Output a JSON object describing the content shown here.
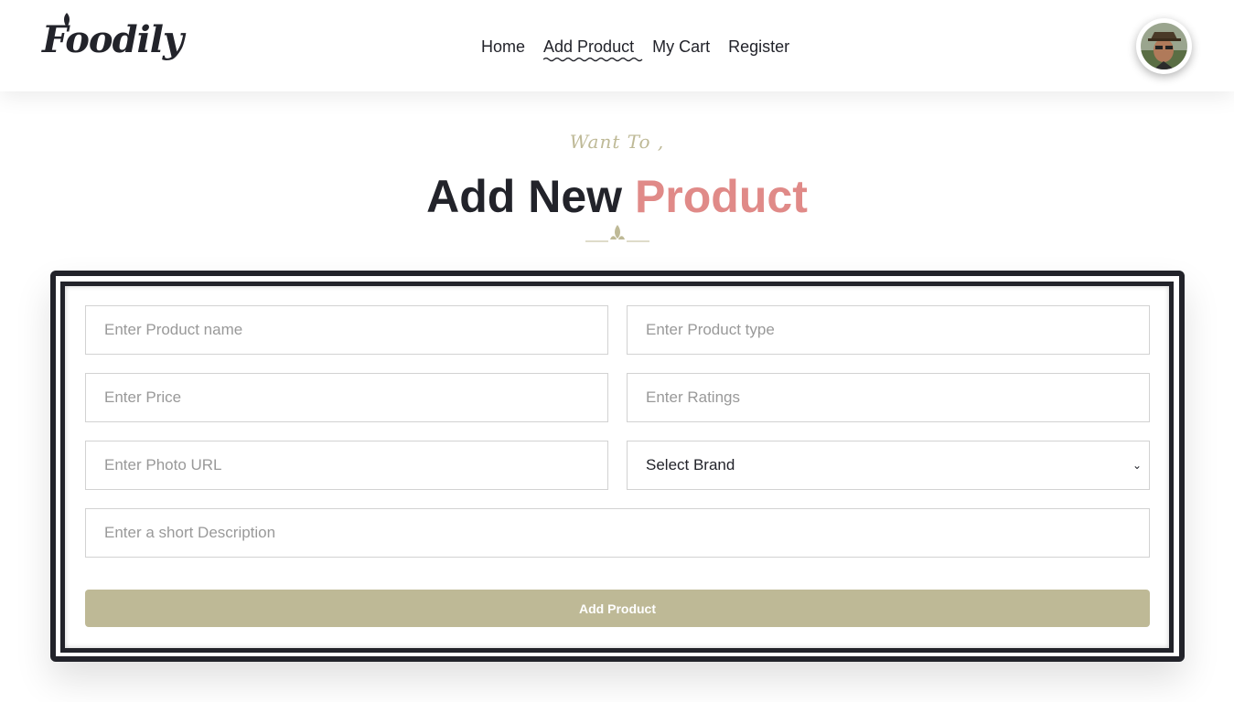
{
  "header": {
    "logo": "Foodily",
    "nav": [
      {
        "label": "Home"
      },
      {
        "label": "Add Product"
      },
      {
        "label": "My Cart"
      },
      {
        "label": "Register"
      }
    ]
  },
  "hero": {
    "eyebrow": "Want To ,",
    "title_main": "Add New",
    "title_accent": "Product"
  },
  "form": {
    "product_name_placeholder": "Enter Product name",
    "product_type_placeholder": "Enter Product type",
    "price_placeholder": "Enter Price",
    "ratings_placeholder": "Enter Ratings",
    "photo_url_placeholder": "Enter Photo URL",
    "brand_selected": "Select Brand",
    "description_placeholder": "Enter a short Description",
    "submit_label": "Add Product"
  },
  "colors": {
    "accent": "#beb996",
    "title_accent": "#e08a88",
    "dark": "#22232a"
  }
}
